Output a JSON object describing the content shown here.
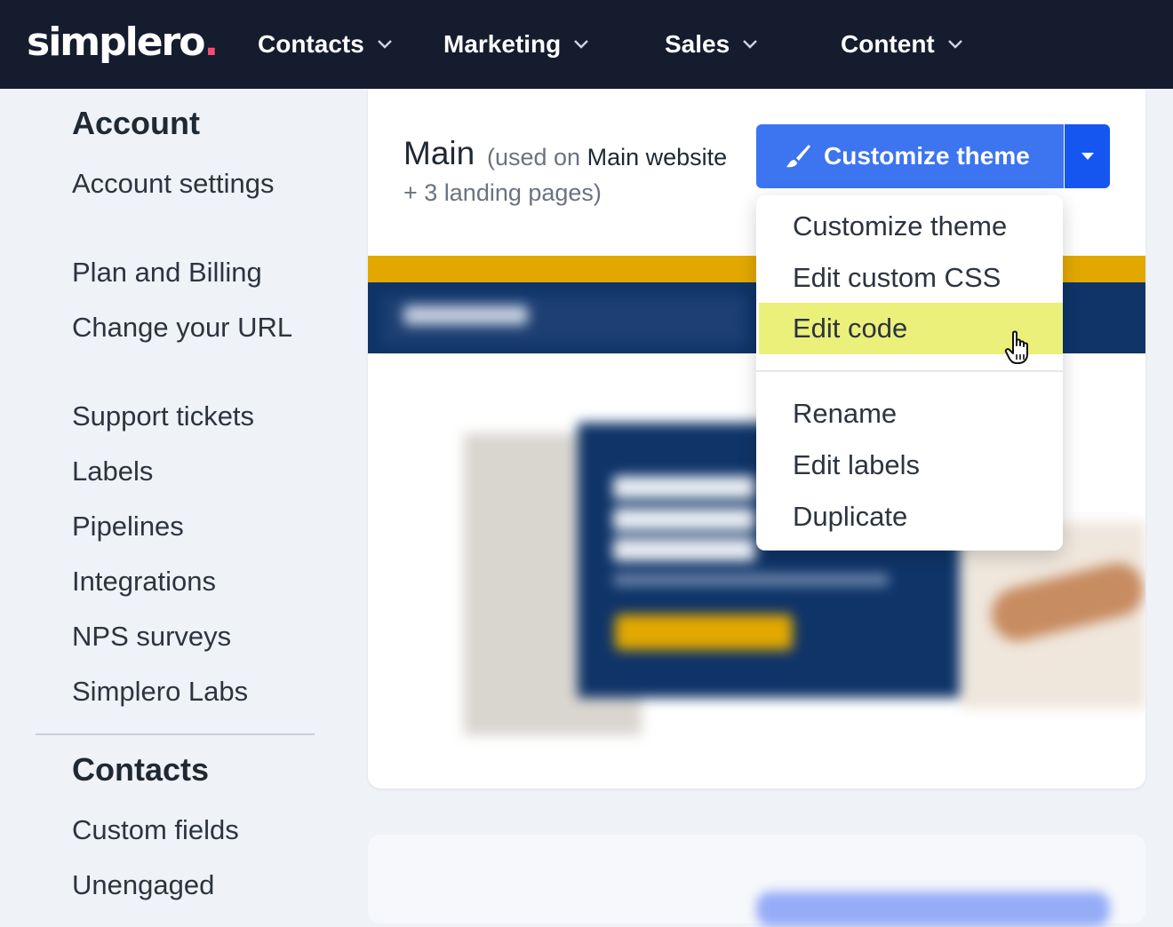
{
  "brand": {
    "name": "simplero",
    "dot": ".",
    "dot_color": "#f0506e"
  },
  "topnav": {
    "items": [
      {
        "label": "Contacts"
      },
      {
        "label": "Marketing"
      },
      {
        "label": "Sales"
      },
      {
        "label": "Content"
      }
    ]
  },
  "sidebar": {
    "sections": [
      {
        "title": "Account",
        "links": [
          "Account settings",
          "Plan and Billing",
          "Change your URL",
          "Support tickets",
          "Labels",
          "Pipelines",
          "Integrations",
          "NPS surveys",
          "Simplero Labs"
        ]
      },
      {
        "title": "Contacts",
        "links": [
          "Custom fields",
          "Unengaged"
        ]
      }
    ]
  },
  "theme_card": {
    "name": "Main",
    "usage_prefix": "(used on ",
    "usage_site": "Main website",
    "usage_suffix": "+ 3 landing pages)",
    "primary_button": {
      "label": "Customize theme",
      "icon": "paintbrush-icon",
      "color": "#3d74f0"
    },
    "dropdown_toggle": {
      "icon": "caret-down-icon",
      "color": "#1656f0"
    },
    "dropdown": {
      "items": [
        {
          "label": "Customize theme"
        },
        {
          "label": "Edit custom CSS"
        },
        {
          "label": "Edit code",
          "highlighted": true
        },
        {
          "label": "Rename"
        },
        {
          "label": "Edit labels"
        },
        {
          "label": "Duplicate"
        }
      ],
      "highlight_color": "#ebf07a"
    }
  },
  "colors": {
    "topbar": "#141c2e",
    "page_bg": "#eff2f7",
    "preview_navy": "#0f3468",
    "preview_gold": "#e2a800"
  }
}
